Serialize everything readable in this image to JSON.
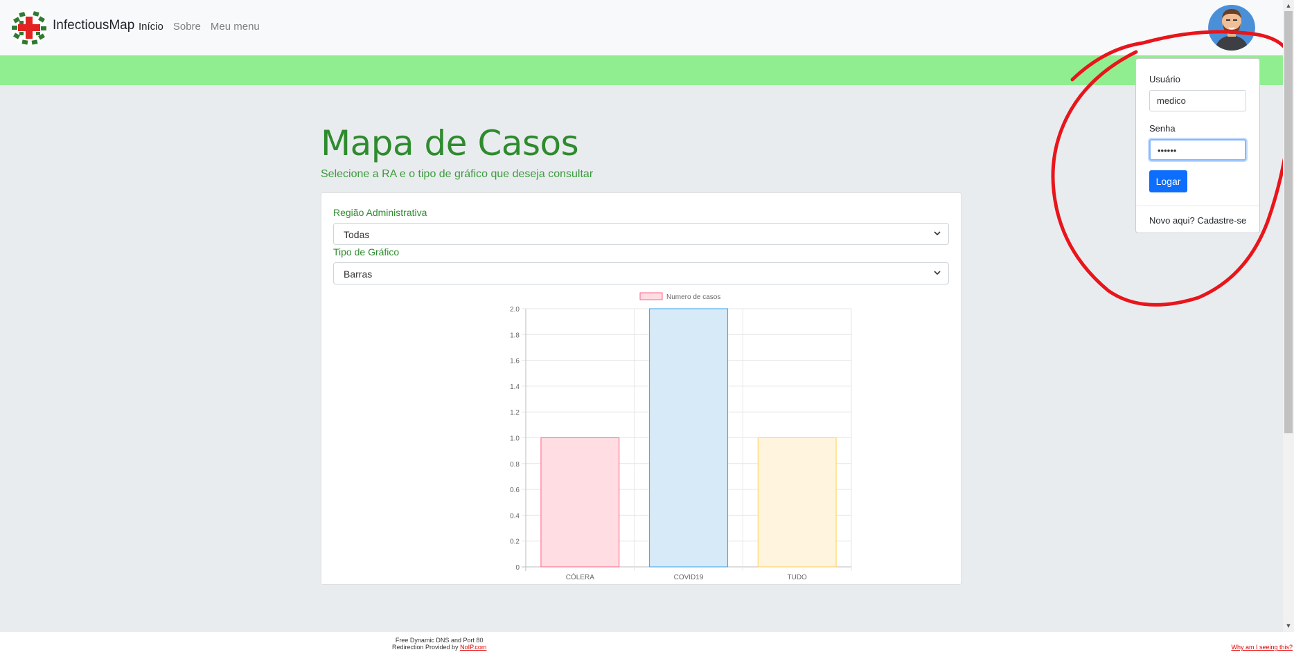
{
  "navbar": {
    "brand": "InfectiousMap",
    "links": [
      "Início",
      "Sobre",
      "Meu menu"
    ]
  },
  "main": {
    "title": "Mapa de Casos",
    "subtitle": "Selecione a RA e o tipo de gráfico que deseja consultar",
    "region_label": "Região Administrativa",
    "region_value": "Todas",
    "chart_type_label": "Tipo de Gráfico",
    "chart_type_value": "Barras"
  },
  "chart_data": {
    "type": "bar",
    "categories": [
      "CÓLERA",
      "COVID19",
      "TUDO"
    ],
    "series": [
      {
        "name": "Numero de casos",
        "values": [
          1,
          2,
          1
        ]
      }
    ],
    "ylim": [
      0,
      2
    ],
    "yticks": [
      "2.0",
      "1.8",
      "1.6",
      "1.4",
      "1.2",
      "1.0",
      "0.8",
      "0.6",
      "0.4",
      "0.2",
      "0"
    ],
    "legend": "top",
    "grid": true,
    "colors": {
      "fills": [
        "#ffdde3",
        "#d6eaf8",
        "#fff4dd"
      ],
      "borders": [
        "#ff6384",
        "#36a2eb",
        "#ffcd56"
      ]
    }
  },
  "login": {
    "user_label": "Usuário",
    "user_value": "medico",
    "pass_label": "Senha",
    "pass_value": "••••••",
    "button": "Logar",
    "signup": "Novo aqui? Cadastre-se"
  },
  "footer": {
    "line1": "Free Dynamic DNS and Port 80",
    "line2_prefix": "Redirection Provided by ",
    "line2_link": "NoIP.com",
    "right_link": "Why am I seeing this?"
  },
  "colors": {
    "accent_green": "#2e8b2e",
    "band_green": "#90ee90",
    "button_blue": "#0d6efd",
    "annotation_red": "#e8151b"
  }
}
